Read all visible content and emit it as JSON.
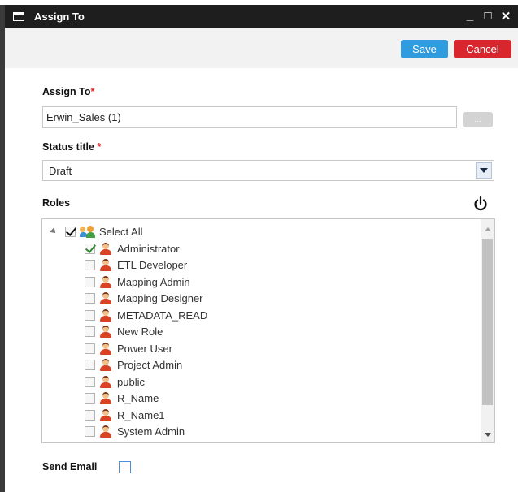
{
  "window": {
    "title": "Assign To",
    "controls": [
      "_",
      "□",
      "✕"
    ]
  },
  "toolbar": {
    "save_label": "Save",
    "cancel_label": "Cancel"
  },
  "assign_to": {
    "label": "Assign To",
    "required_mark": "*",
    "value": "Erwin_Sales (1)",
    "browse_label": "..."
  },
  "status": {
    "label": "Status title",
    "required_mark": "*",
    "value": "Draft"
  },
  "roles": {
    "label": "Roles",
    "select_all": "Select All",
    "items": [
      {
        "label": "Administrator",
        "checked": true
      },
      {
        "label": "ETL Developer",
        "checked": false
      },
      {
        "label": "Mapping Admin",
        "checked": false
      },
      {
        "label": "Mapping Designer",
        "checked": false
      },
      {
        "label": "METADATA_READ",
        "checked": false
      },
      {
        "label": "New Role",
        "checked": false
      },
      {
        "label": "Power User",
        "checked": false
      },
      {
        "label": "Project Admin",
        "checked": false
      },
      {
        "label": "public",
        "checked": false
      },
      {
        "label": "R_Name",
        "checked": false
      },
      {
        "label": "R_Name1",
        "checked": false
      },
      {
        "label": "System Admin",
        "checked": false
      }
    ]
  },
  "send_email": {
    "label": "Send Email",
    "checked": false
  },
  "colors": {
    "save": "#2e9cdf",
    "cancel": "#d9262c",
    "required": "#e0262b",
    "checkmark": "#2f8a2f"
  }
}
